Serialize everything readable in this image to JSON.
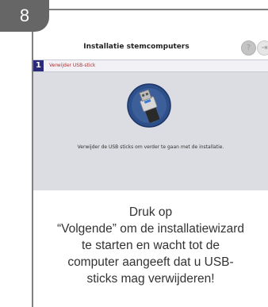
{
  "step_badge": {
    "number": "8"
  },
  "window": {
    "title": "Installatie stemcomputers",
    "help_icon": "help-icon",
    "exit_icon": "exit-icon",
    "current_step": {
      "number": "1",
      "label": "Verwijder USB-stick"
    },
    "graphic_icon": "usb-stick-icon",
    "instruction": "Verwijder de USB sticks om verder te gaan met de installatie."
  },
  "caption": {
    "lines": [
      "Druk op",
      "“Volgende” om de installatiewizard",
      "te starten en wacht tot de",
      "computer aangeeft dat u USB-",
      "sticks mag verwijderen!"
    ]
  },
  "colors": {
    "badge": "#666666",
    "step_number_bg": "#2b2a7a",
    "window_bg": "#dcdce3",
    "icon_circle": "#2d4f8a"
  }
}
